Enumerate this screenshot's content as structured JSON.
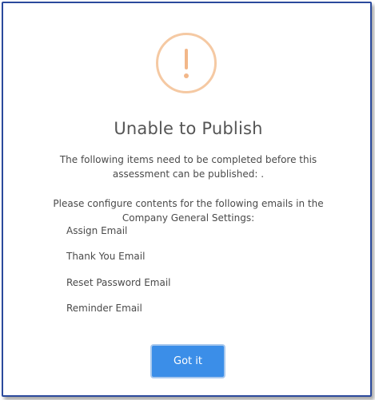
{
  "dialog": {
    "icon": "exclamation-icon",
    "title": "Unable to Publish",
    "message": "The following items need to be completed before this assessment can be published: .",
    "instruction": "Please configure contents for the following emails in the Company General Settings:",
    "emails": [
      "Assign Email",
      "Thank You Email",
      "Reset Password Email",
      "Reminder Email"
    ],
    "confirm_label": "Got it"
  },
  "colors": {
    "accent": "#3b8ee8",
    "warning": "#f2b789",
    "frame": "#2b4a9c"
  }
}
